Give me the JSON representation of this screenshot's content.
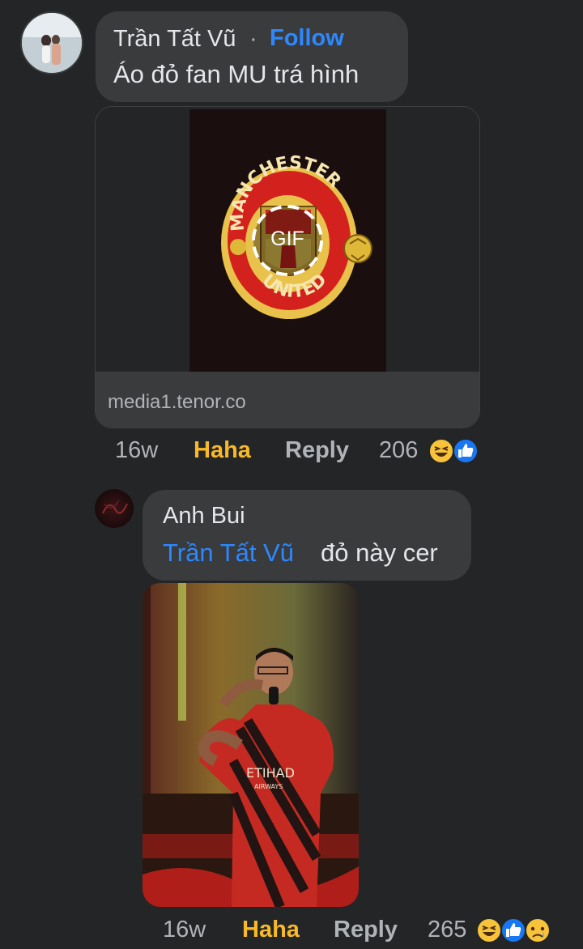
{
  "comments": [
    {
      "author": "Trần Tất Vũ",
      "separator": "·",
      "follow_label": "Follow",
      "text": "Áo đỏ fan MU trá hình",
      "attachment": {
        "type": "gif",
        "badge": "GIF",
        "crest_top_text": "MANCHESTER",
        "crest_bottom_text": "UNITED",
        "domain": "media1.tenor.co"
      },
      "time": "16w",
      "reaction_label": "Haha",
      "reply_label": "Reply",
      "reaction_count": "206",
      "reaction_icons": [
        "haha-icon",
        "like-icon"
      ]
    },
    {
      "author": "Anh Bui",
      "mention": "Trần Tất Vũ",
      "text": "đỏ này cer",
      "attachment": {
        "type": "photo",
        "shirt_text": "ETIHAD",
        "shirt_subtext": "AIRWAYS"
      },
      "time": "16w",
      "reaction_label": "Haha",
      "reply_label": "Reply",
      "reaction_count": "265",
      "reaction_icons": [
        "haha-icon",
        "like-icon",
        "sad-icon"
      ]
    }
  ],
  "colors": {
    "background": "#242526",
    "bubble": "#3a3b3c",
    "link_blue": "#2d88ff",
    "haha_yellow": "#f7b928",
    "muted_text": "#b0b3b8"
  }
}
